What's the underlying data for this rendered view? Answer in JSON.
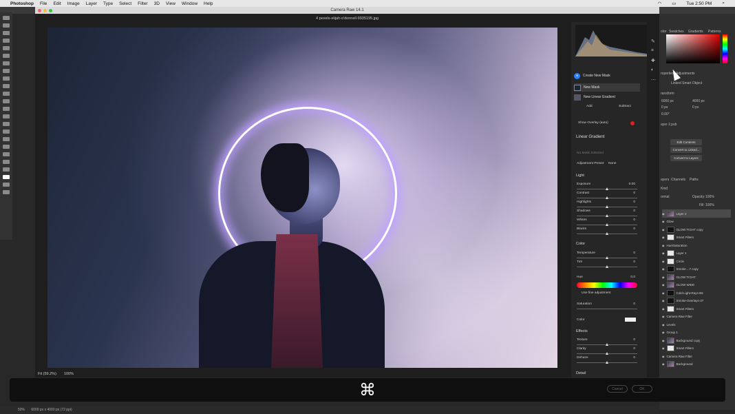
{
  "mac_menu": {
    "apple": "",
    "app": "Photoshop",
    "items": [
      "File",
      "Edit",
      "Image",
      "Layer",
      "Type",
      "Select",
      "Filter",
      "3D",
      "View",
      "Window",
      "Help"
    ],
    "clock": "Tue 2:50 PM"
  },
  "camera_raw": {
    "title": "Camera Raw 14.1",
    "filename": "4 pexels-elijah-o'donnell-9935195.jpg",
    "fit_label": "Fit (59.2%)",
    "zoom_label": "100%",
    "masks": {
      "create_label": "Create New Mask",
      "new_mask": "New Mask",
      "linear_gradient": "New Linear Gradient",
      "add": "Add",
      "subtract": "Subtract",
      "show_overlay": "Show Overlay (auto)"
    },
    "panel_title": "Linear Gradient",
    "preset_placeholder": "No Mask Selected",
    "adjustment_preset_label": "Adjustment Preset",
    "adjustment_preset_value": "None",
    "light": {
      "heading": "Light",
      "rows": [
        {
          "label": "Exposure",
          "value": "0.00"
        },
        {
          "label": "Contrast",
          "value": "0"
        },
        {
          "label": "Highlights",
          "value": "0"
        },
        {
          "label": "Shadows",
          "value": "0"
        },
        {
          "label": "Whites",
          "value": "0"
        },
        {
          "label": "Blacks",
          "value": "0"
        }
      ]
    },
    "color": {
      "heading": "Color",
      "rows": [
        {
          "label": "Temperature",
          "value": "0"
        },
        {
          "label": "Tint",
          "value": "0"
        }
      ],
      "hue_label": "Hue",
      "hue_value": "0.0",
      "fine_adjust": "Use fine adjustment",
      "saturation_label": "Saturation",
      "saturation_value": "0",
      "color_label": "Color"
    },
    "effects": {
      "heading": "Effects",
      "rows": [
        {
          "label": "Texture",
          "value": "0"
        },
        {
          "label": "Clarity",
          "value": "0"
        },
        {
          "label": "Dehaze",
          "value": "0"
        }
      ]
    },
    "detail_heading": "Detail",
    "cancel": "Cancel",
    "ok": "OK"
  },
  "ps_panels": {
    "color_tabs": [
      "olor",
      "Swatches",
      "Gradients",
      "Patterns"
    ],
    "properties_tabs": [
      "roperties",
      "Adjustments"
    ],
    "properties_type": "Linked Smart Object",
    "transform_label": "ransform",
    "w": "6000 px",
    "h": "4000 px",
    "x": "0 px",
    "y": "0 px",
    "angle": "0.00°",
    "layer_comp": "ayer 2.psb",
    "edit_contents": "Edit Contents",
    "convert_linked": "Convert to Linked...",
    "convert_layers": "Convert to Layers",
    "layer_tabs": [
      "ayers",
      "Channels",
      "Paths"
    ],
    "kind_label": "Kind",
    "blend_mode": "ormal",
    "opacity_label": "Opacity:",
    "opacity_value": "100%",
    "fill_label": "Fill:",
    "fill_value": "100%"
  },
  "layers": [
    {
      "name": "Layer 2",
      "thumb": "img",
      "sel": true
    },
    {
      "name": "Glow",
      "thumb": "none",
      "sel": false
    },
    {
      "name": "GLOW TIGHT copy",
      "thumb": "dark",
      "sel": false
    },
    {
      "name": "Smart Filters",
      "thumb": "plain",
      "sel": false
    },
    {
      "name": "Hue/Saturation",
      "thumb": "none",
      "sel": false
    },
    {
      "name": "Layer 1",
      "thumb": "plain",
      "sel": false
    },
    {
      "name": "Circle",
      "thumb": "plain",
      "sel": false
    },
    {
      "name": "Smoke....7 copy",
      "thumb": "dark",
      "sel": false
    },
    {
      "name": "GLOW TIGHT",
      "thumb": "img",
      "sel": false
    },
    {
      "name": "GLOW WIDE",
      "thumb": "img",
      "sel": false
    },
    {
      "name": "Cold-Light-Rays-B5",
      "thumb": "dark",
      "sel": false
    },
    {
      "name": "Smoke-Overlays-37",
      "thumb": "dark",
      "sel": false
    },
    {
      "name": "Smart Filters",
      "thumb": "plain",
      "sel": false
    },
    {
      "name": "Camera Raw Filter",
      "thumb": "none",
      "sel": false
    },
    {
      "name": "Levels",
      "thumb": "none",
      "sel": false
    },
    {
      "name": "Group 1",
      "thumb": "none",
      "sel": false
    },
    {
      "name": "Background copy",
      "thumb": "img",
      "sel": false
    },
    {
      "name": "Smart Filters",
      "thumb": "plain",
      "sel": false
    },
    {
      "name": "Camera Raw Filter",
      "thumb": "none",
      "sel": false
    },
    {
      "name": "Background",
      "thumb": "img",
      "sel": false
    }
  ],
  "status": {
    "zoom": "50%",
    "doc_info": "6000 px x 4000 px (72 ppi)"
  },
  "overlay": {
    "icon": "command-key-icon",
    "glyph": "⌘"
  },
  "colors": {
    "accent": "#2d7ff9",
    "overlay_red": "#e02020"
  }
}
